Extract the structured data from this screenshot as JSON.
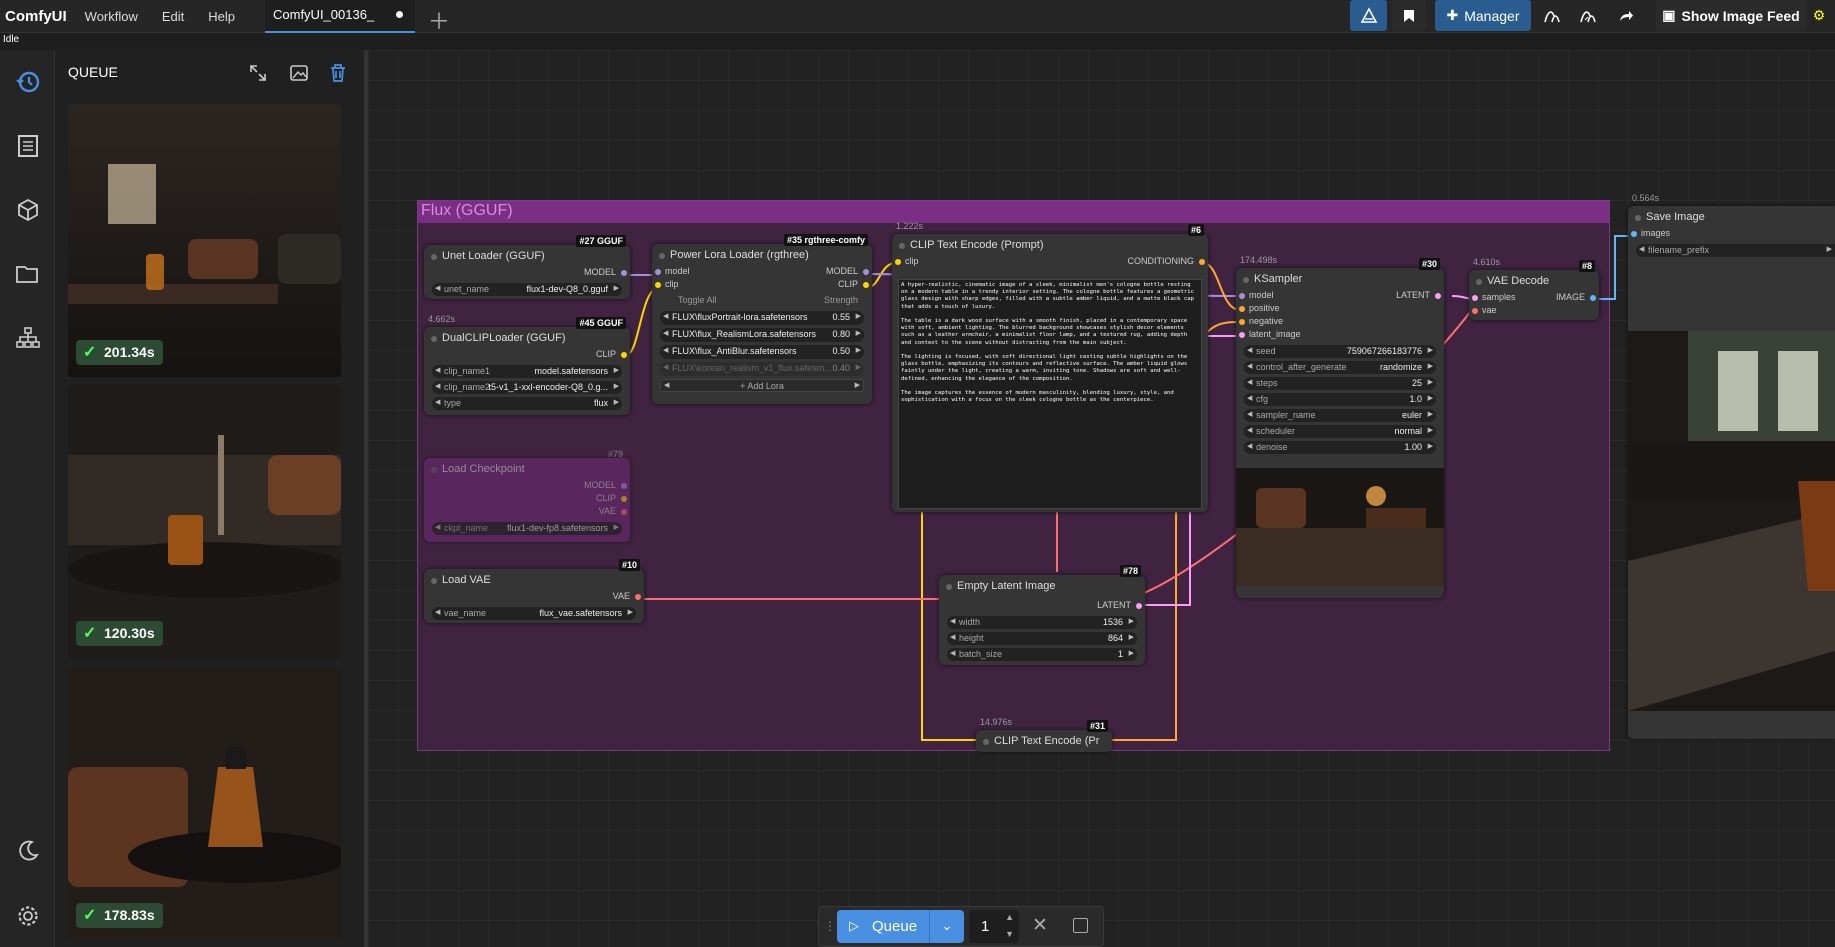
{
  "app": {
    "logo": "ComfyUI",
    "menus": [
      "Workflow",
      "Edit",
      "Help"
    ],
    "tab_title": "ComfyUI_00136_",
    "status": "Idle"
  },
  "toolbar": {
    "manager_label": "Manager",
    "show_feed_label": "Show Image Feed"
  },
  "queue": {
    "title": "QUEUE",
    "items": [
      {
        "time": "201.34s"
      },
      {
        "time": "120.30s"
      },
      {
        "time": "178.83s"
      }
    ]
  },
  "group": {
    "title": "Flux (GGUF)"
  },
  "nodes": {
    "unet": {
      "id": "#27 GGUF",
      "title": "Unet Loader (GGUF)",
      "out": "MODEL",
      "w_name": "unet_name",
      "w_val": "flux1-dev-Q8_0.gguf"
    },
    "dualclip": {
      "id": "#45 GGUF",
      "time": "4.662s",
      "title": "DualCLIPLoader (GGUF)",
      "out": "CLIP",
      "widgets": [
        {
          "n": "clip_name1",
          "v": "model.safetensors"
        },
        {
          "n": "clip_name2",
          "v": "t5-v1_1-xxl-encoder-Q8_0.g..."
        },
        {
          "n": "type",
          "v": "flux"
        }
      ]
    },
    "lora": {
      "id": "#35 rgthree-comfy",
      "title": "Power Lora Loader (rgthree)",
      "in1": "model",
      "in2": "clip",
      "out1": "MODEL",
      "out2": "CLIP",
      "toggle": "Toggle All",
      "strength": "Strength",
      "loras": [
        {
          "n": "FLUX\\fluxPortrait-lora.safetensors",
          "v": "0.55"
        },
        {
          "n": "FLUX\\flux_RealismLora.safetensors",
          "v": "0.80"
        },
        {
          "n": "FLUX\\flux_AntiBlur.safetensors",
          "v": "0.50"
        },
        {
          "n": "FLUX\\korean_realism_v1_flux.safeten...",
          "v": "0.40"
        }
      ],
      "add": "+ Add Lora"
    },
    "checkpoint": {
      "id": "#79",
      "title": "Load Checkpoint",
      "o1": "MODEL",
      "o2": "CLIP",
      "o3": "VAE",
      "w_name": "ckpt_name",
      "w_val": "flux1-dev-fp8.safetensors"
    },
    "vae": {
      "id": "#10",
      "title": "Load VAE",
      "out": "VAE",
      "w_name": "vae_name",
      "w_val": "flux_vae.safetensors"
    },
    "clip_text": {
      "id": "#6",
      "time": "1.222s",
      "title": "CLIP Text Encode (Prompt)",
      "in": "clip",
      "out": "CONDITIONING",
      "text": "A hyper-realistic, cinematic image of a sleek, minimalist men's cologne bottle resting on a modern table in a trendy interior setting. The cologne bottle features a geometric glass design with sharp edges, filled with a subtle amber liquid, and a matte black cap that adds a touch of luxury.\n\nThe table is a dark wood surface with a smooth finish, placed in a contemporary space with soft, ambient lighting. The blurred background showcases stylish decor elements such as a leather armchair, a minimalist floor lamp, and a textured rug, adding depth and context to the scene without distracting from the main subject.\n\nThe lighting is focused, with soft directional light casting subtle highlights on the glass bottle, emphasizing its contours and reflective surface. The amber liquid glows faintly under the light, creating a warm, inviting tone. Shadows are soft and well-defined, enhancing the elegance of the composition.\n\nThe image captures the essence of modern masculinity, blending luxury, style, and sophistication with a focus on the sleek cologne bottle as the centerpiece."
    },
    "ksampler": {
      "id": "#30",
      "time": "174.498s",
      "title": "KSampler",
      "inputs": [
        "model",
        "positive",
        "negative",
        "latent_image"
      ],
      "out": "LATENT",
      "widgets": [
        {
          "n": "seed",
          "v": "759067266183776"
        },
        {
          "n": "control_after_generate",
          "v": "randomize"
        },
        {
          "n": "steps",
          "v": "25"
        },
        {
          "n": "cfg",
          "v": "1.0"
        },
        {
          "n": "sampler_name",
          "v": "euler"
        },
        {
          "n": "scheduler",
          "v": "normal"
        },
        {
          "n": "denoise",
          "v": "1.00"
        }
      ]
    },
    "vaedecode": {
      "id": "#8",
      "time": "4.610s",
      "title": "VAE Decode",
      "in1": "samples",
      "in2": "vae",
      "out": "IMAGE"
    },
    "empty_latent": {
      "id": "#78",
      "title": "Empty Latent Image",
      "out": "LATENT",
      "widgets": [
        {
          "n": "width",
          "v": "1536"
        },
        {
          "n": "height",
          "v": "864"
        },
        {
          "n": "batch_size",
          "v": "1"
        }
      ]
    },
    "clip_text2": {
      "id": "#31",
      "time": "14.976s",
      "title": "CLIP Text Encode (Pr"
    },
    "save": {
      "time": "0.564s",
      "title": "Save Image",
      "in": "images",
      "w": "filename_prefix"
    }
  },
  "bottom": {
    "queue_label": "Queue",
    "count": "1"
  }
}
